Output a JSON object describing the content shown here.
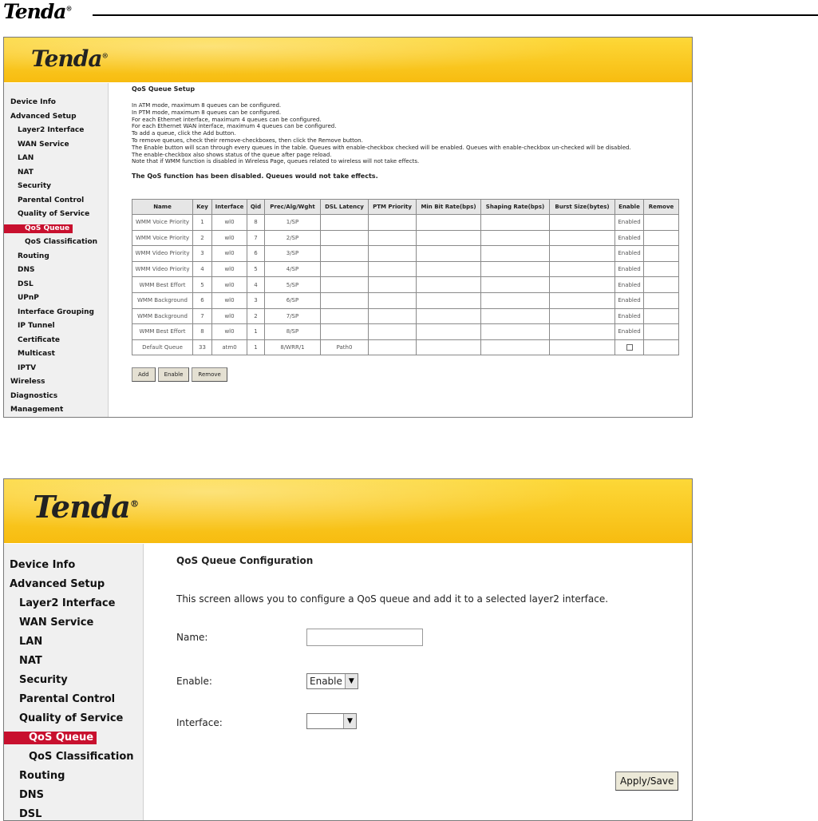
{
  "doc_logo": "Tenda",
  "registered_mark": "®",
  "screen1": {
    "brand": "Tenda",
    "sidebar": [
      {
        "label": "Device Info",
        "level": 1
      },
      {
        "label": "Advanced Setup",
        "level": 1
      },
      {
        "label": "Layer2 Interface",
        "level": 2
      },
      {
        "label": "WAN Service",
        "level": 2
      },
      {
        "label": "LAN",
        "level": 2
      },
      {
        "label": "NAT",
        "level": 2
      },
      {
        "label": "Security",
        "level": 2
      },
      {
        "label": "Parental Control",
        "level": 2
      },
      {
        "label": "Quality of Service",
        "level": 2
      },
      {
        "label": "QoS Queue",
        "level": 3,
        "active": true
      },
      {
        "label": "QoS Classification",
        "level": 3
      },
      {
        "label": "Routing",
        "level": 2
      },
      {
        "label": "DNS",
        "level": 2
      },
      {
        "label": "DSL",
        "level": 2
      },
      {
        "label": "UPnP",
        "level": 2
      },
      {
        "label": "Interface Grouping",
        "level": 2
      },
      {
        "label": "IP Tunnel",
        "level": 2
      },
      {
        "label": "Certificate",
        "level": 2
      },
      {
        "label": "Multicast",
        "level": 2
      },
      {
        "label": "IPTV",
        "level": 2
      },
      {
        "label": "Wireless",
        "level": 1
      },
      {
        "label": "Diagnostics",
        "level": 1
      },
      {
        "label": "Management",
        "level": 1
      }
    ],
    "title": "QoS Queue Setup",
    "lines": [
      "In ATM mode, maximum 8 queues can be configured.",
      "In PTM mode, maximum 8 queues can be configured.",
      "For each Ethernet interface, maximum 4 queues can be configured.",
      "For each Ethernet WAN interface, maximum 4 queues can be configured.",
      "To add a queue, click the Add button.",
      "To remove queues, check their remove-checkboxes, then click the Remove button.",
      "The Enable button will scan through every queues in the table. Queues with enable-checkbox checked will be enabled. Queues with enable-checkbox un-checked will be disabled.",
      "The enable-checkbox also shows status of the queue after page reload.",
      "Note that if WMM function is disabled in Wireless Page, queues related to wireless will not take effects."
    ],
    "warning": "The QoS function has been disabled. Queues would not take effects.",
    "columns": [
      "Name",
      "Key",
      "Interface",
      "Qid",
      "Prec/Alg/Wght",
      "DSL Latency",
      "PTM Priority",
      "Min Bit Rate(bps)",
      "Shaping Rate(bps)",
      "Burst Size(bytes)",
      "Enable",
      "Remove"
    ],
    "rows": [
      {
        "name": "WMM Voice Priority",
        "key": "1",
        "iface": "wl0",
        "qid": "8",
        "prec": "1/SP",
        "latency": "",
        "enable": "Enabled"
      },
      {
        "name": "WMM Voice Priority",
        "key": "2",
        "iface": "wl0",
        "qid": "7",
        "prec": "2/SP",
        "latency": "",
        "enable": "Enabled"
      },
      {
        "name": "WMM Video Priority",
        "key": "3",
        "iface": "wl0",
        "qid": "6",
        "prec": "3/SP",
        "latency": "",
        "enable": "Enabled"
      },
      {
        "name": "WMM Video Priority",
        "key": "4",
        "iface": "wl0",
        "qid": "5",
        "prec": "4/SP",
        "latency": "",
        "enable": "Enabled"
      },
      {
        "name": "WMM Best Effort",
        "key": "5",
        "iface": "wl0",
        "qid": "4",
        "prec": "5/SP",
        "latency": "",
        "enable": "Enabled"
      },
      {
        "name": "WMM Background",
        "key": "6",
        "iface": "wl0",
        "qid": "3",
        "prec": "6/SP",
        "latency": "",
        "enable": "Enabled"
      },
      {
        "name": "WMM Background",
        "key": "7",
        "iface": "wl0",
        "qid": "2",
        "prec": "7/SP",
        "latency": "",
        "enable": "Enabled"
      },
      {
        "name": "WMM Best Effort",
        "key": "8",
        "iface": "wl0",
        "qid": "1",
        "prec": "8/SP",
        "latency": "",
        "enable": "Enabled"
      },
      {
        "name": "Default Queue",
        "key": "33",
        "iface": "atm0",
        "qid": "1",
        "prec": "8/WRR/1",
        "latency": "Path0",
        "enable": "checkbox"
      }
    ],
    "buttons": {
      "add": "Add",
      "enable": "Enable",
      "remove": "Remove"
    }
  },
  "screen2": {
    "brand": "Tenda",
    "sidebar": [
      {
        "label": "Device Info",
        "level": 1
      },
      {
        "label": "Advanced Setup",
        "level": 1
      },
      {
        "label": "Layer2 Interface",
        "level": 2
      },
      {
        "label": "WAN Service",
        "level": 2
      },
      {
        "label": "LAN",
        "level": 2
      },
      {
        "label": "NAT",
        "level": 2
      },
      {
        "label": "Security",
        "level": 2
      },
      {
        "label": "Parental Control",
        "level": 2
      },
      {
        "label": "Quality of Service",
        "level": 2
      },
      {
        "label": "QoS Queue",
        "level": 3,
        "active": true
      },
      {
        "label": "QoS Classification",
        "level": 3
      },
      {
        "label": "Routing",
        "level": 2
      },
      {
        "label": "DNS",
        "level": 2
      },
      {
        "label": "DSL",
        "level": 2
      }
    ],
    "title": "QoS Queue Configuration",
    "description": "This screen allows you to configure a QoS queue and add it to a selected layer2 interface.",
    "name_label": "Name:",
    "name_value": "",
    "enable_label": "Enable:",
    "enable_value": "Enable",
    "interface_label": "Interface:",
    "interface_value": "",
    "apply_label": "Apply/Save"
  }
}
